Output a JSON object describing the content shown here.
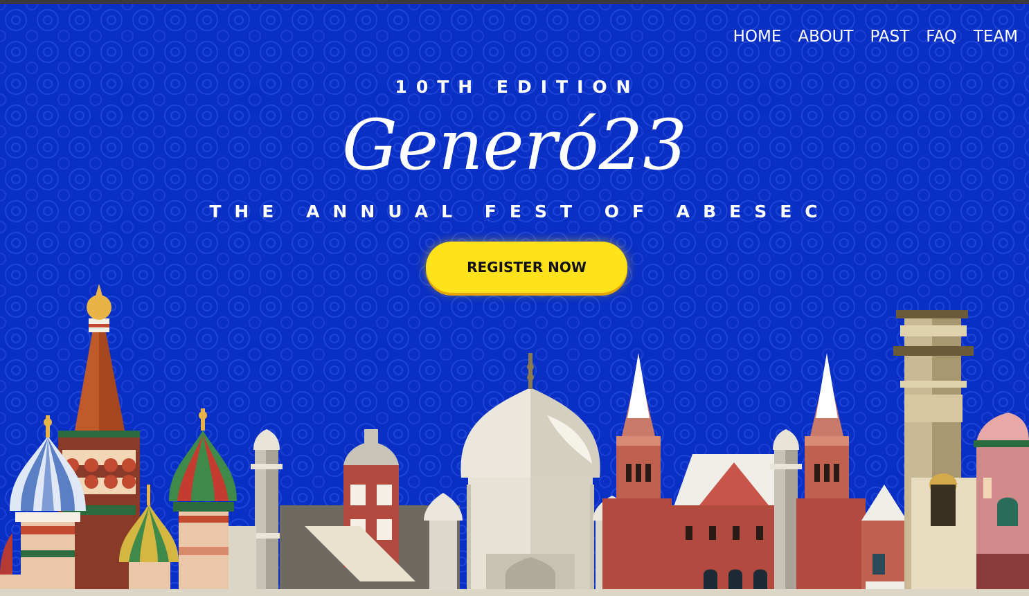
{
  "nav": {
    "items": [
      {
        "label": "HOME"
      },
      {
        "label": "ABOUT"
      },
      {
        "label": "PAST"
      },
      {
        "label": "FAQ"
      },
      {
        "label": "TEAM"
      }
    ]
  },
  "hero": {
    "edition": "10TH EDITION",
    "title": "Generó23",
    "tagline": "THE ANNUAL FEST OF ABESEC",
    "cta_label": "REGISTER NOW"
  },
  "colors": {
    "background": "#0a2fc4",
    "cta": "#ffe21a",
    "text": "#ffffff"
  },
  "illustration": "world-landmarks-skyline"
}
